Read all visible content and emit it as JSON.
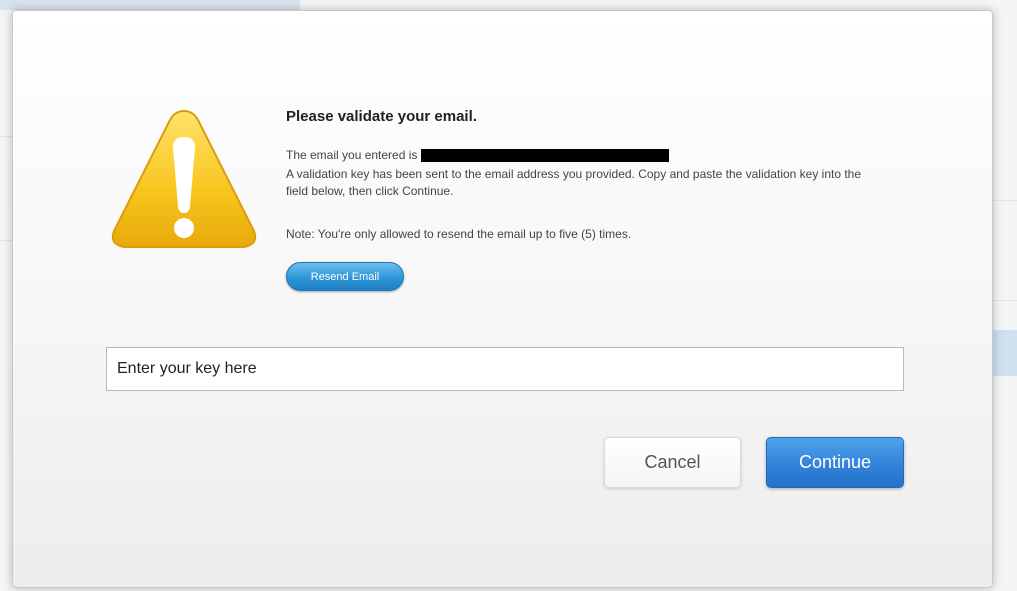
{
  "dialog": {
    "title": "Please validate your email.",
    "entered_prefix": "The email you entered is",
    "sent_message": "A validation key has been sent to the email address you provided. Copy and paste the validation key into the field below, then click Continue.",
    "note": "Note: You're only allowed to resend the email up to five (5) times.",
    "resend_label": "Resend Email",
    "key_input": {
      "value": "Enter your key here",
      "placeholder": ""
    },
    "cancel_label": "Cancel",
    "continue_label": "Continue"
  },
  "icons": {
    "warning": "warning-triangle-icon"
  },
  "colors": {
    "warning_yellow": "#f7c51c",
    "primary_blue": "#2f80d8",
    "resend_blue": "#2f95d6"
  }
}
